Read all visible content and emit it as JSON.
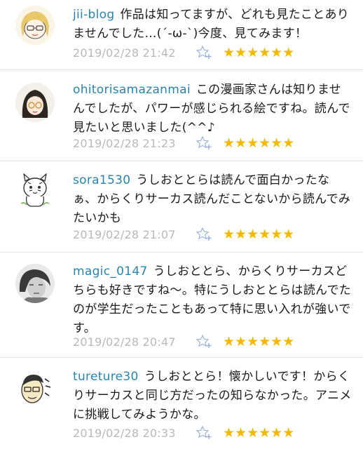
{
  "comments": [
    {
      "username": "jii-blog",
      "text": "作品は知ってますが、どれも見たことありませんでした…(´-ω-`)今度、見てみます！",
      "time": "2019/02/28 21:42",
      "stars": "★★★★★★"
    },
    {
      "username": "ohitorisamazanmai",
      "text": "この漫画家さんは知りませんでしたが、パワーが感じられる絵ですね。読んで見たいと思いました(^^♪",
      "time": "2019/02/28 21:23",
      "stars": "★★★★★★"
    },
    {
      "username": "sora1530",
      "text": "うしおととらは読んで面白かったなぁ、からくりサーカス読んだことないから読んでみたいかも",
      "time": "2019/02/28 21:07",
      "stars": "★★★★★★"
    },
    {
      "username": "magic_0147",
      "text": "うしおととら、からくりサーカスどちらも好きですね～。特にうしおととらは読んでたのが学生だったこともあって特に思い入れが強いです。",
      "time": "2019/02/28 20:47",
      "stars": "★★★★★★"
    },
    {
      "username": "tureture30",
      "text": "うしおととら！懐かしいです！からくりサーカスと同じ方だったの知らなかった。アニメに挑戦してみようかな。",
      "time": "2019/02/28 20:33",
      "stars": "★★★★★★"
    }
  ],
  "icons": {
    "add_star": "star-add-icon",
    "star": "star-icon"
  },
  "colors": {
    "username": "#2a83ad",
    "star": "#f5b800",
    "timestamp": "#b9b9b9"
  }
}
